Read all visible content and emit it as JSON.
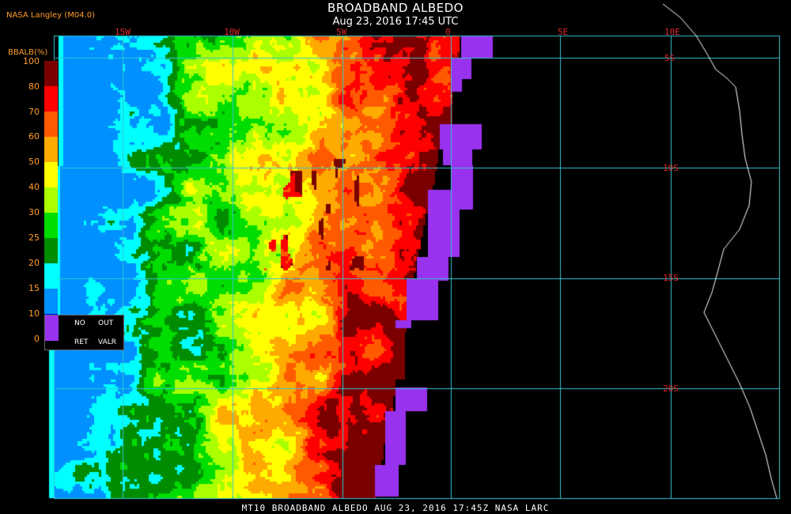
{
  "header": {
    "title": "BROADBAND ALBEDO",
    "subtitle": "Aug 23, 2016 17:45 UTC",
    "credit": "NASA Langley (M04.0)"
  },
  "colorbar": {
    "title": "BBALB(%)",
    "ticks": [
      "100",
      "80",
      "70",
      "60",
      "50",
      "40",
      "30",
      "25",
      "20",
      "15",
      "10",
      "0"
    ],
    "colors": [
      "#7a0000",
      "#ff0000",
      "#ff5a00",
      "#ffaa00",
      "#ffff00",
      "#aaff00",
      "#00dd00",
      "#008c00",
      "#00ffff",
      "#0090ff",
      "#0000ff",
      "#9932ee"
    ],
    "no_data_labels": [
      "NO",
      "OUT",
      "RET",
      "VALR"
    ]
  },
  "grid": {
    "longitudes": [
      "15W",
      "10W",
      "5W",
      "0",
      "5E",
      "10E"
    ],
    "latitudes": [
      "5S",
      "10S",
      "15S",
      "20S"
    ],
    "line_color": "#34c6d4",
    "label_color": "#e0282a"
  },
  "footer": {
    "text": "MT10  BROADBAND ALBEDO   AUG 23, 2016 17:45Z  NASA LARC"
  }
}
